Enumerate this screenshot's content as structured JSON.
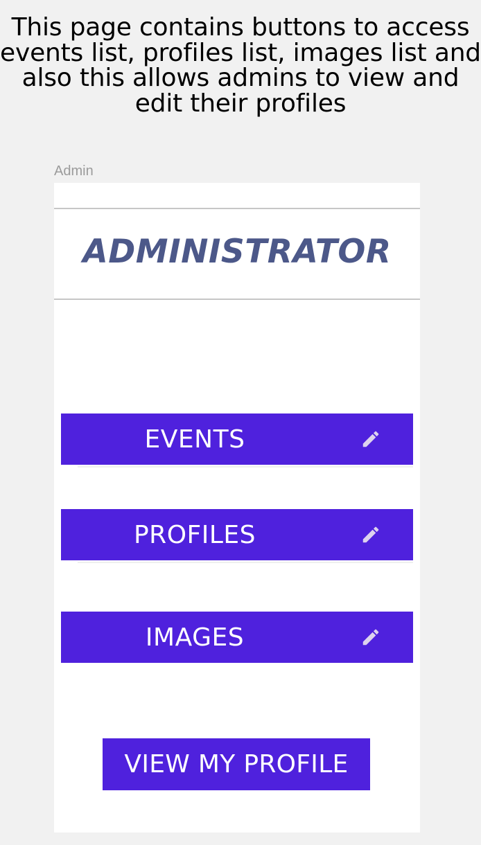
{
  "description": {
    "text": "This page contains buttons to access events list, profiles list, images list and also this allows admins to view and edit their profiles"
  },
  "frame": {
    "label": "Admin"
  },
  "app": {
    "title": "ADMINISTRATOR"
  },
  "buttons": {
    "events": {
      "label": "EVENTS",
      "icon": "pencil-icon"
    },
    "profiles": {
      "label": "PROFILES",
      "icon": "pencil-icon"
    },
    "images": {
      "label": "IMAGES",
      "icon": "pencil-icon"
    },
    "view_profile": {
      "label": "VIEW MY PROFILE"
    }
  },
  "colors": {
    "button_background": "#4f21dd",
    "title_color": "#4c5889",
    "icon_color": "#ddd2ee"
  }
}
